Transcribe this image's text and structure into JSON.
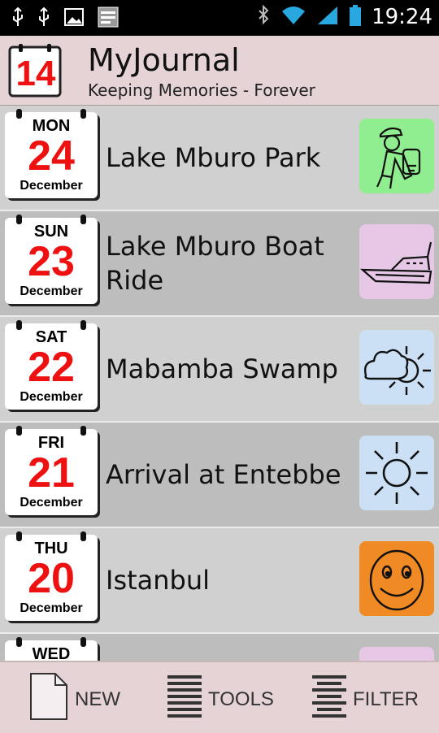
{
  "status_bar": {
    "time": "19:24",
    "icons_left": [
      "usb-icon",
      "usb-icon",
      "image-icon",
      "app-icon"
    ],
    "icons_right": [
      "bluetooth-icon",
      "wifi-icon",
      "signal-icon",
      "battery-icon"
    ]
  },
  "header": {
    "icon_day": "14",
    "title": "MyJournal",
    "subtitle": "Keeping Memories - Forever"
  },
  "entries": [
    {
      "dow": "MON",
      "day": "24",
      "month": "December",
      "title": "Lake Mburo Park",
      "thumb": "hiker-icon",
      "thumb_color": "#90ee90"
    },
    {
      "dow": "SUN",
      "day": "23",
      "month": "December",
      "title": "Lake Mburo Boat Ride",
      "thumb": "boat-icon",
      "thumb_color": "#e6c7e6"
    },
    {
      "dow": "SAT",
      "day": "22",
      "month": "December",
      "title": "Mabamba Swamp",
      "thumb": "cloud-sun-icon",
      "thumb_color": "#cce0f5"
    },
    {
      "dow": "FRI",
      "day": "21",
      "month": "December",
      "title": "Arrival at Entebbe",
      "thumb": "sun-icon",
      "thumb_color": "#cce0f5"
    },
    {
      "dow": "THU",
      "day": "20",
      "month": "December",
      "title": "Istanbul",
      "thumb": "smiley-icon",
      "thumb_color": "#f08a24"
    },
    {
      "dow": "WED",
      "day": "",
      "month": "",
      "title": "",
      "thumb": "partial-icon",
      "thumb_color": "#e6c7e6"
    }
  ],
  "bottom_bar": {
    "new_label": "NEW",
    "tools_label": "TOOLS",
    "filter_label": "FILTER"
  }
}
